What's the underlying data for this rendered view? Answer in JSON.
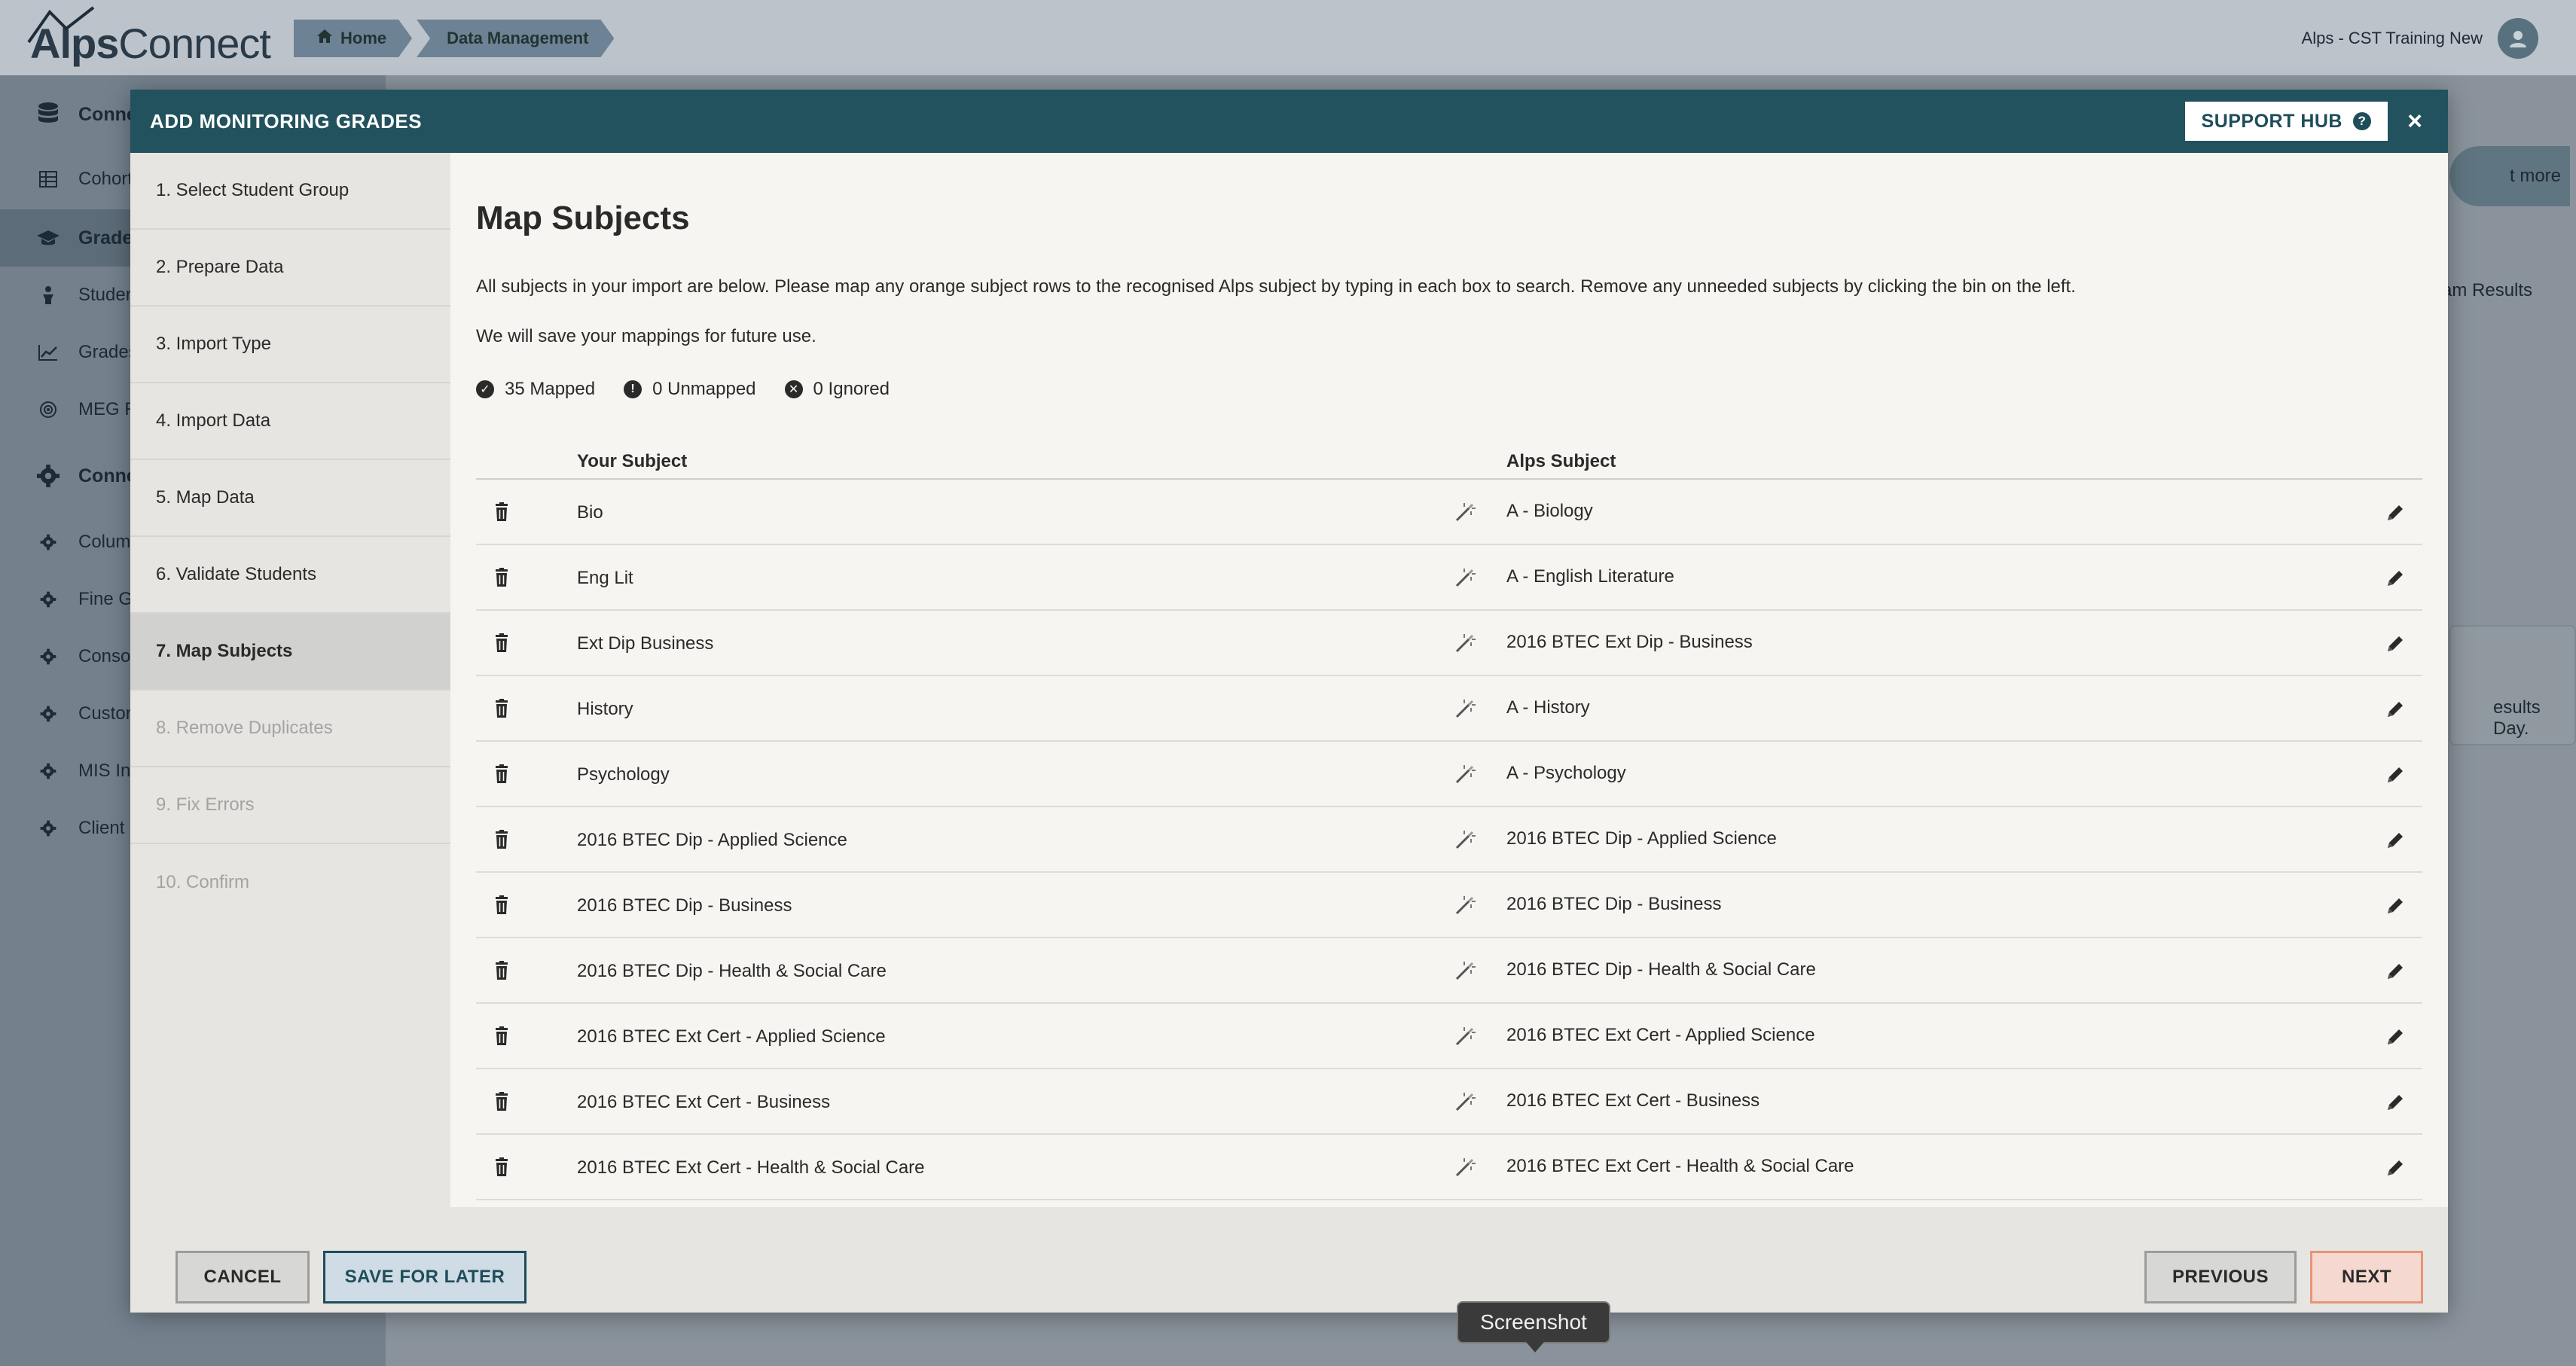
{
  "app": {
    "logo": {
      "part1": "Alps",
      "part2": "Connect"
    },
    "breadcrumb": [
      {
        "label": "Home"
      },
      {
        "label": "Data Management"
      }
    ],
    "account_name": "Alps - CST Training New",
    "sidebar": {
      "items": [
        {
          "label": "Conne",
          "icon": "database-icon",
          "bold": true
        },
        {
          "label": "Cohort",
          "icon": "grid-icon"
        },
        {
          "label": "Grade",
          "icon": "graduation-cap-icon",
          "bold": true
        },
        {
          "label": "Studer",
          "icon": "student-icon"
        },
        {
          "label": "Grades",
          "icon": "line-chart-icon"
        },
        {
          "label": "MEG R",
          "icon": "target-icon"
        },
        {
          "label": "Conne",
          "icon": "gear-icon",
          "bold": true
        },
        {
          "label": "Colum",
          "icon": "gear-icon"
        },
        {
          "label": "Fine G",
          "icon": "gear-icon"
        },
        {
          "label": "Conso",
          "icon": "gear-icon"
        },
        {
          "label": "Custor",
          "icon": "gear-icon"
        },
        {
          "label": "MIS Int",
          "icon": "gear-icon"
        },
        {
          "label": "Client",
          "icon": "gear-icon"
        }
      ]
    },
    "background": {
      "learn_more": "t more",
      "exam_results": "am Results",
      "results_day": "esults Day."
    }
  },
  "modal": {
    "title": "ADD MONITORING GRADES",
    "support_hub_label": "SUPPORT HUB",
    "close_glyph": "×",
    "steps": [
      {
        "label": "1. Select Student Group",
        "state": "done"
      },
      {
        "label": "2. Prepare Data",
        "state": "done"
      },
      {
        "label": "3. Import Type",
        "state": "done"
      },
      {
        "label": "4. Import Data",
        "state": "done"
      },
      {
        "label": "5. Map Data",
        "state": "done"
      },
      {
        "label": "6. Validate Students",
        "state": "done"
      },
      {
        "label": "7. Map Subjects",
        "state": "active"
      },
      {
        "label": "8. Remove Duplicates",
        "state": "disabled"
      },
      {
        "label": "9. Fix Errors",
        "state": "disabled"
      },
      {
        "label": "10. Confirm",
        "state": "disabled"
      }
    ],
    "content": {
      "heading": "Map Subjects",
      "instructions": "All subjects in your import are below. Please map any orange subject rows to the recognised Alps subject by typing in each box to search. Remove any unneeded subjects by clicking the bin on the left.",
      "save_note": "We will save your mappings for future use.",
      "counts": {
        "mapped": "35 Mapped",
        "unmapped": "0 Unmapped",
        "ignored": "0 Ignored"
      },
      "table": {
        "col_your_subject": "Your Subject",
        "col_alps_subject": "Alps Subject",
        "rows": [
          {
            "yours": "Bio",
            "alps": "A - Biology"
          },
          {
            "yours": "Eng Lit",
            "alps": "A - English Literature"
          },
          {
            "yours": "Ext Dip Business",
            "alps": "2016 BTEC Ext Dip - Business"
          },
          {
            "yours": "History",
            "alps": "A - History"
          },
          {
            "yours": "Psychology",
            "alps": "A - Psychology"
          },
          {
            "yours": "2016 BTEC Dip - Applied Science",
            "alps": "2016 BTEC Dip - Applied Science"
          },
          {
            "yours": "2016 BTEC Dip - Business",
            "alps": "2016 BTEC Dip - Business"
          },
          {
            "yours": "2016 BTEC Dip - Health & Social Care",
            "alps": "2016 BTEC Dip - Health & Social Care"
          },
          {
            "yours": "2016 BTEC Ext Cert - Applied Science",
            "alps": "2016 BTEC Ext Cert - Applied Science"
          },
          {
            "yours": "2016 BTEC Ext Cert - Business",
            "alps": "2016 BTEC Ext Cert - Business"
          },
          {
            "yours": "2016 BTEC Ext Cert - Health & Social Care",
            "alps": "2016 BTEC Ext Cert - Health & Social Care"
          }
        ]
      }
    },
    "footer": {
      "cancel_label": "CANCEL",
      "save_later_label": "SAVE FOR LATER",
      "previous_label": "PREVIOUS",
      "next_label": "NEXT"
    }
  },
  "tooltip": {
    "label": "Screenshot"
  },
  "colors": {
    "header_teal": "#21525e",
    "modal_bg": "#f6f5f1",
    "steps_bg": "#e6e5e1",
    "next_accent": "#e79478",
    "save_accent": "#1f4d5a"
  }
}
